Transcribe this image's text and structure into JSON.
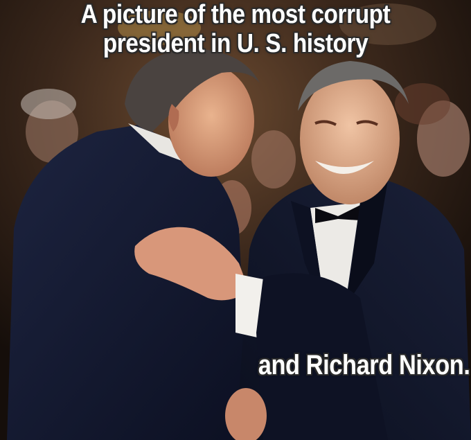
{
  "meme": {
    "caption_top_line1": "A picture of the most corrupt",
    "caption_top_line2": "president in U. S. history",
    "caption_bottom": "and Richard Nixon."
  },
  "colors": {
    "caption_text": "#ffffff",
    "caption_outline": "#2a2a2a",
    "tuxedo": "#141a2e",
    "background_warm": "#5a3a24"
  }
}
